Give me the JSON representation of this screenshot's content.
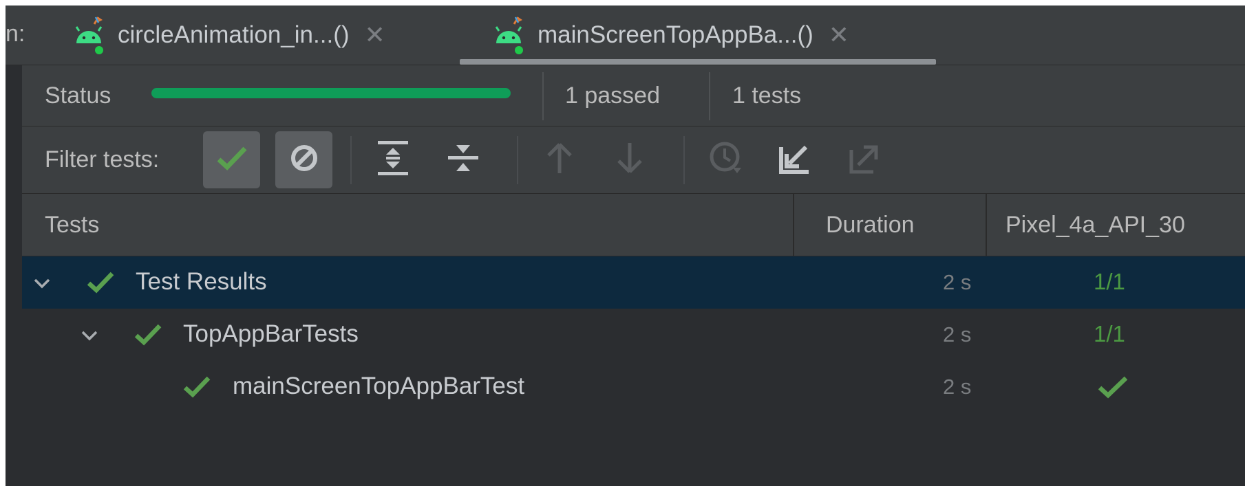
{
  "tabbar": {
    "prefix": "n:",
    "tabs": [
      {
        "label": "circleAnimation_in...()",
        "close": "✕",
        "active": false
      },
      {
        "label": "mainScreenTopAppBa...()",
        "close": "✕",
        "active": true
      }
    ]
  },
  "status": {
    "label": "Status",
    "progress": 1.0,
    "passed": "1 passed",
    "tests": "1 tests"
  },
  "toolbar": {
    "filter_label": "Filter tests:",
    "icons": [
      "show-passed-icon",
      "show-ignored-icon",
      "expand-all-icon",
      "collapse-all-icon",
      "previous-failed-icon",
      "next-failed-icon",
      "test-history-icon",
      "import-tests-icon",
      "export-tests-icon"
    ]
  },
  "table": {
    "columns": {
      "tests": "Tests",
      "duration": "Duration",
      "device": "Pixel_4a_API_30"
    },
    "rows": [
      {
        "label": "Test Results",
        "duration": "2 s",
        "result": "1/1"
      },
      {
        "label": "TopAppBarTests",
        "duration": "2 s",
        "result": "1/1"
      },
      {
        "label": "mainScreenTopAppBarTest",
        "duration": "2 s",
        "result": ""
      }
    ]
  },
  "colors": {
    "accent_green": "#0f9d58",
    "check_green": "#5aa04f",
    "selection": "#0d293e",
    "android_green": "#3ddc84"
  }
}
